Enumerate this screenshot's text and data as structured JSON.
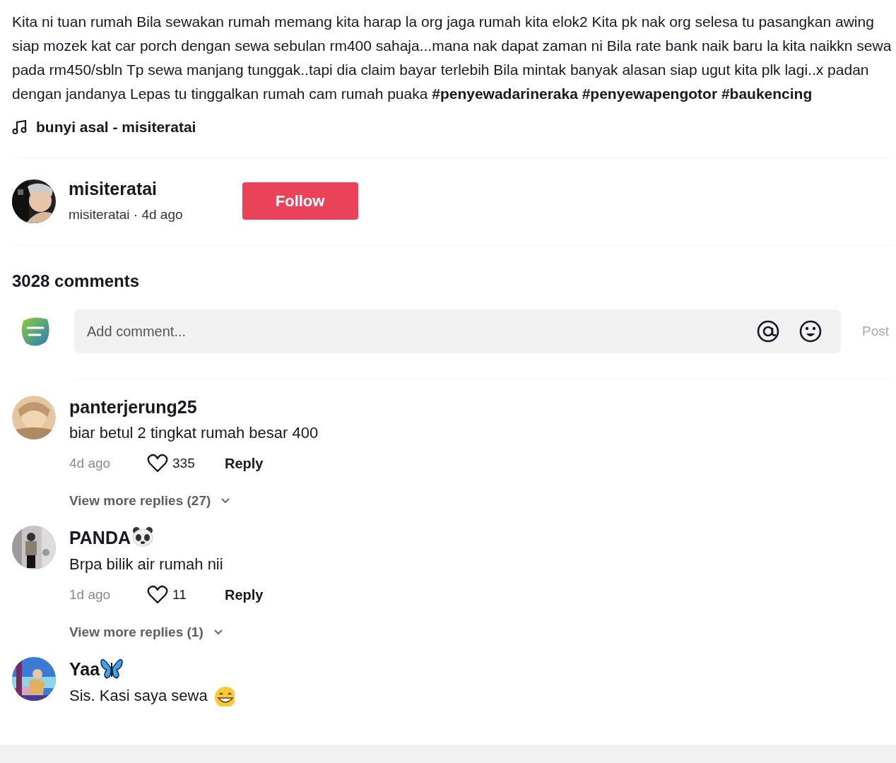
{
  "caption": "Kita ni tuan rumah Bila sewakan rumah memang kita harap la org jaga rumah kita elok2 Kita pk nak org selesa tu pasangkan awing siap mozek kat car porch dengan sewa sebulan rm400 sahaja...mana nak dapat zaman ni Bila rate bank naik baru la kita naikkn sewa pada rm450/sbln Tp sewa manjang tunggak..tapi dia claim bayar terlebih Bila mintak banyak alasan siap ugut kita plk lagi..x padan dengan jandanya Lepas tu tinggalkan rumah cam rumah puaka **#penyewadarineraka #penyewapengotor #baukencing**",
  "music": {
    "title": "bunyi asal - misiteratai"
  },
  "author": {
    "name": "misiteratai",
    "subtitle": "misiteratai · 4d ago",
    "follow_button": "Follow"
  },
  "comments_count": "3028 comments",
  "comment_box": {
    "placeholder": "Add comment...",
    "post_button": "Post"
  },
  "comments": [
    {
      "username": "panterjerung25",
      "text": "biar betul 2 tingkat rumah besar 400",
      "time": "4d ago",
      "liked": false,
      "likes": "335",
      "reply": "Reply",
      "view_replies": "View more replies (27)"
    },
    {
      "username": "PANDA",
      "name_icon": {
        "kind": "panda"
      },
      "text": "Brpa bilik air rumah nii",
      "time": "1d ago",
      "liked": false,
      "likes": "11",
      "reply": "Reply",
      "view_replies": "View more replies (1)"
    },
    {
      "username": "Yaa",
      "name_icon": {
        "kind": "butterfly"
      },
      "text": "Sis. Kasi saya sewa",
      "text_icon": {
        "kind": "grin"
      }
    }
  ]
}
